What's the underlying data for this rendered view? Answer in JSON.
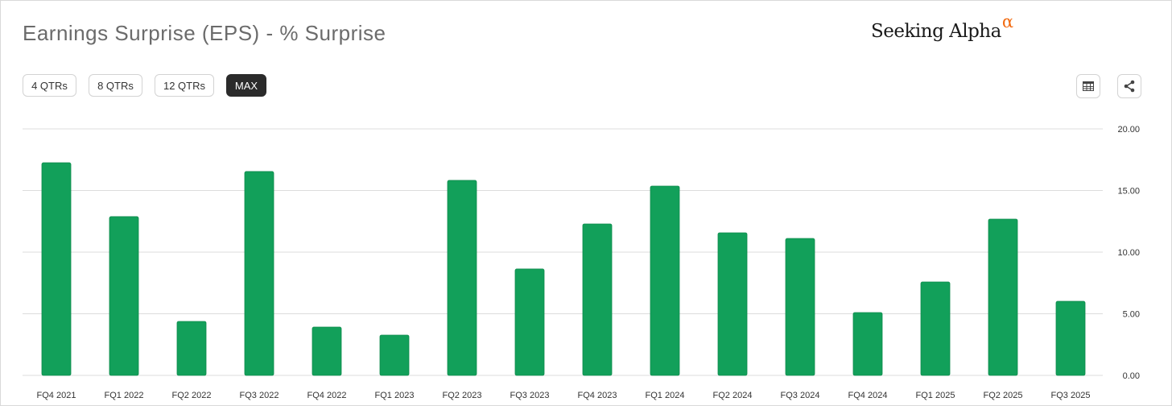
{
  "title": "Earnings Surprise (EPS) - % Surprise",
  "logo": {
    "text": "Seeking Alpha",
    "mark": "α"
  },
  "range_buttons": [
    {
      "label": "4 QTRs",
      "active": false
    },
    {
      "label": "8 QTRs",
      "active": false
    },
    {
      "label": "12 QTRs",
      "active": false
    },
    {
      "label": "MAX",
      "active": true
    }
  ],
  "toolbar": {
    "table_icon": "table-icon",
    "share_icon": "share-icon"
  },
  "colors": {
    "bar": "#12a05a",
    "bar_border": "#0e8a4c",
    "grid": "#dcdcdc",
    "accent": "#f26b11"
  },
  "chart_data": {
    "type": "bar",
    "title": "Earnings Surprise (EPS) - % Surprise",
    "xlabel": "",
    "ylabel": "",
    "ylim": [
      0,
      20
    ],
    "yticks": [
      "0.00",
      "5.00",
      "10.00",
      "15.00",
      "20.00"
    ],
    "ytick_values": [
      0,
      5,
      10,
      15,
      20
    ],
    "grid": true,
    "categories": [
      "FQ4 2021",
      "FQ1 2022",
      "FQ2 2022",
      "FQ3 2022",
      "FQ4 2022",
      "FQ1 2023",
      "FQ2 2023",
      "FQ3 2023",
      "FQ4 2023",
      "FQ1 2024",
      "FQ2 2024",
      "FQ3 2024",
      "FQ4 2024",
      "FQ1 2025",
      "FQ2 2025",
      "FQ3 2025"
    ],
    "values": [
      17.25,
      12.88,
      4.38,
      16.54,
      3.92,
      3.27,
      15.82,
      8.63,
      12.29,
      15.36,
      11.57,
      11.11,
      5.1,
      7.58,
      12.68,
      6.01
    ]
  }
}
